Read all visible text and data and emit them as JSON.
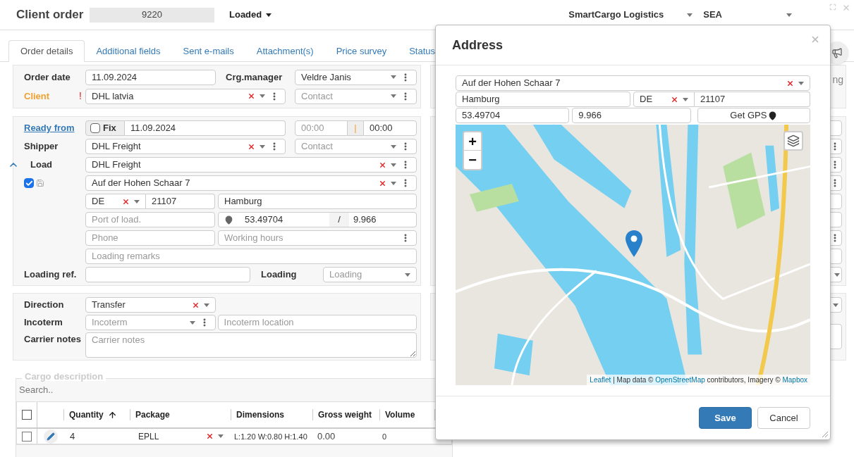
{
  "header": {
    "title": "Client order",
    "order_number": "9220",
    "status": "Loaded",
    "company": "SmartCargo Logistics",
    "mode": "SEA"
  },
  "tabs": [
    {
      "label": "Order details",
      "selected": true
    },
    {
      "label": "Additional fields",
      "selected": false
    },
    {
      "label": "Sent e-mails",
      "selected": false
    },
    {
      "label": "Attachment(s)",
      "selected": false
    },
    {
      "label": "Price survey",
      "selected": false
    },
    {
      "label": "Status",
      "selected": false
    }
  ],
  "order": {
    "order_date_label": "Order date",
    "order_date": "11.09.2024",
    "manager_label": "Crg.manager",
    "manager": "Veldre Janis",
    "client_label": "Client",
    "required_mark": "!",
    "client": "DHL latvia",
    "contact_placeholder": "Contact"
  },
  "loading": {
    "ready_from_label": "Ready from",
    "fix_label": "Fix",
    "fix_checked": false,
    "ready_date": "11.09.2024",
    "time_from_placeholder": "00:00",
    "time_separator": "|",
    "time_to": "00:00",
    "shipper_label": "Shipper",
    "shipper": "DHL Freight",
    "shipper_contact_placeholder": "Contact",
    "load_label": "Load",
    "load": "DHL Freight",
    "address_checked": true,
    "address": "Auf der Hohen Schaar 7",
    "country": "DE",
    "postcode": "21107",
    "city": "Hamburg",
    "port_placeholder": "Port of load.",
    "lat": "53.49704",
    "coord_separator": "/",
    "lon": "9.966",
    "phone_placeholder": "Phone",
    "hours_placeholder": "Working hours",
    "remarks_placeholder": "Loading remarks",
    "ref_label": "Loading ref.",
    "type_label": "Loading",
    "type_placeholder": "Loading"
  },
  "transport": {
    "direction_label": "Direction",
    "direction": "Transfer",
    "incoterm_label": "Incoterm",
    "incoterm_placeholder": "Incoterm",
    "incoterm_location_placeholder": "Incoterm location",
    "notes_label": "Carrier notes",
    "notes_placeholder": "Carrier notes"
  },
  "cargo": {
    "title": "Cargo description",
    "search_placeholder": "Search..",
    "all_checked": false,
    "columns": [
      {
        "label": "Quantity",
        "sorted": true
      },
      {
        "label": "Package",
        "sorted": false
      },
      {
        "label": "Dimensions",
        "sorted": false
      },
      {
        "label": "Gross weight",
        "sorted": false
      },
      {
        "label": "Volume",
        "sorted": false
      }
    ],
    "rows": [
      {
        "checked": false,
        "quantity": "4",
        "package": "EPLL",
        "dimensions": "L:1.20 W:0.80 H:1.40",
        "gross_weight": "0.00",
        "volume": "0"
      }
    ]
  },
  "right_panel": {
    "label_fragment": "ng"
  },
  "modal": {
    "title": "Address",
    "address": "Auf der Hohen Schaar 7",
    "city": "Hamburg",
    "country": "DE",
    "postcode": "21107",
    "lat": "53.49704",
    "lon": "9.966",
    "gps_button": "Get GPS",
    "map": {
      "kind": "picture",
      "zoom_in": "+",
      "zoom_out": "−",
      "attribution": [
        {
          "text": "Leaflet",
          "link": true
        },
        {
          "text": " | Map data © ",
          "link": false
        },
        {
          "text": "OpenStreetMap",
          "link": true
        },
        {
          "text": " contributors, Imagery © ",
          "link": false
        },
        {
          "text": "Mapbox",
          "link": true
        }
      ]
    },
    "buttons": [
      {
        "label": "Save",
        "kind": "primary"
      },
      {
        "label": "Cancel",
        "kind": "default"
      }
    ]
  }
}
